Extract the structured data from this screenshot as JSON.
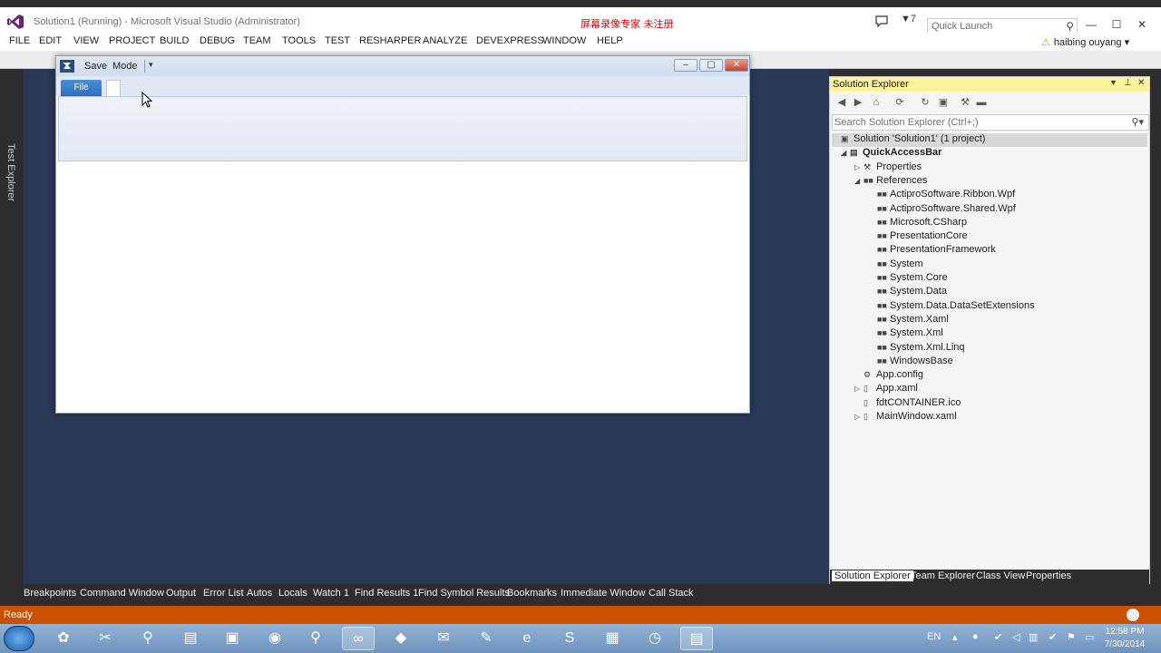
{
  "titlebar": {
    "title": "Solution1 (Running) - Microsoft Visual Studio (Administrator)",
    "watermark": "屏幕录像专家  未注册",
    "notification_count": "7",
    "quick_launch_placeholder": "Quick Launch"
  },
  "menu": {
    "items": [
      "FILE",
      "EDIT",
      "VIEW",
      "PROJECT",
      "BUILD",
      "DEBUG",
      "TEAM",
      "TOOLS",
      "TEST",
      "RESHARPER",
      "ANALYZE",
      "DEVEXPRESS",
      "WINDOW",
      "HELP"
    ],
    "user": "haibing ouyang"
  },
  "left_tab": {
    "label": "Test Explorer"
  },
  "app_window": {
    "qa_save": "Save",
    "qa_mode": "Mode",
    "file_tab": "File"
  },
  "solution_explorer": {
    "title": "Solution Explorer",
    "search_placeholder": "Search Solution Explorer (Ctrl+;)",
    "tree": [
      {
        "label": "Solution 'Solution1' (1 project)",
        "indent": 0,
        "expander": "",
        "icon": "solution"
      },
      {
        "label": "QuickAccessBar",
        "indent": 0,
        "expander": "◢",
        "icon": "csproj",
        "bold": true
      },
      {
        "label": "Properties",
        "indent": 1,
        "expander": "▷",
        "icon": "wrench"
      },
      {
        "label": "References",
        "indent": 1,
        "expander": "◢",
        "icon": "ref"
      },
      {
        "label": "ActiproSoftware.Ribbon.Wpf",
        "indent": 2,
        "expander": "",
        "icon": "ref"
      },
      {
        "label": "ActiproSoftware.Shared.Wpf",
        "indent": 2,
        "expander": "",
        "icon": "ref"
      },
      {
        "label": "Microsoft.CSharp",
        "indent": 2,
        "expander": "",
        "icon": "ref"
      },
      {
        "label": "PresentationCore",
        "indent": 2,
        "expander": "",
        "icon": "ref"
      },
      {
        "label": "PresentationFramework",
        "indent": 2,
        "expander": "",
        "icon": "ref"
      },
      {
        "label": "System",
        "indent": 2,
        "expander": "",
        "icon": "ref"
      },
      {
        "label": "System.Core",
        "indent": 2,
        "expander": "",
        "icon": "ref"
      },
      {
        "label": "System.Data",
        "indent": 2,
        "expander": "",
        "icon": "ref"
      },
      {
        "label": "System.Data.DataSetExtensions",
        "indent": 2,
        "expander": "",
        "icon": "ref"
      },
      {
        "label": "System.Xaml",
        "indent": 2,
        "expander": "",
        "icon": "ref"
      },
      {
        "label": "System.Xml",
        "indent": 2,
        "expander": "",
        "icon": "ref"
      },
      {
        "label": "System.Xml.Linq",
        "indent": 2,
        "expander": "",
        "icon": "ref"
      },
      {
        "label": "WindowsBase",
        "indent": 2,
        "expander": "",
        "icon": "ref"
      },
      {
        "label": "App.config",
        "indent": 1,
        "expander": "",
        "icon": "config"
      },
      {
        "label": "App.xaml",
        "indent": 1,
        "expander": "▷",
        "icon": "xaml"
      },
      {
        "label": "fdtCONTAINER.ico",
        "indent": 1,
        "expander": "",
        "icon": "file"
      },
      {
        "label": "MainWindow.xaml",
        "indent": 1,
        "expander": "▷",
        "icon": "xaml"
      }
    ],
    "tabs": [
      "Solution Explorer",
      "Team Explorer",
      "Class View",
      "Properties"
    ]
  },
  "tool_windows": [
    "Breakpoints",
    "Command Window",
    "Output",
    "Error List",
    "Autos",
    "Locals",
    "Watch 1",
    "Find Results 1",
    "Find Symbol Results",
    "Bookmarks",
    "Immediate Window",
    "Call Stack"
  ],
  "status": {
    "text": "Ready"
  },
  "taskbar": {
    "language": "EN",
    "time": "12:58 PM",
    "date": "7/30/2014"
  }
}
